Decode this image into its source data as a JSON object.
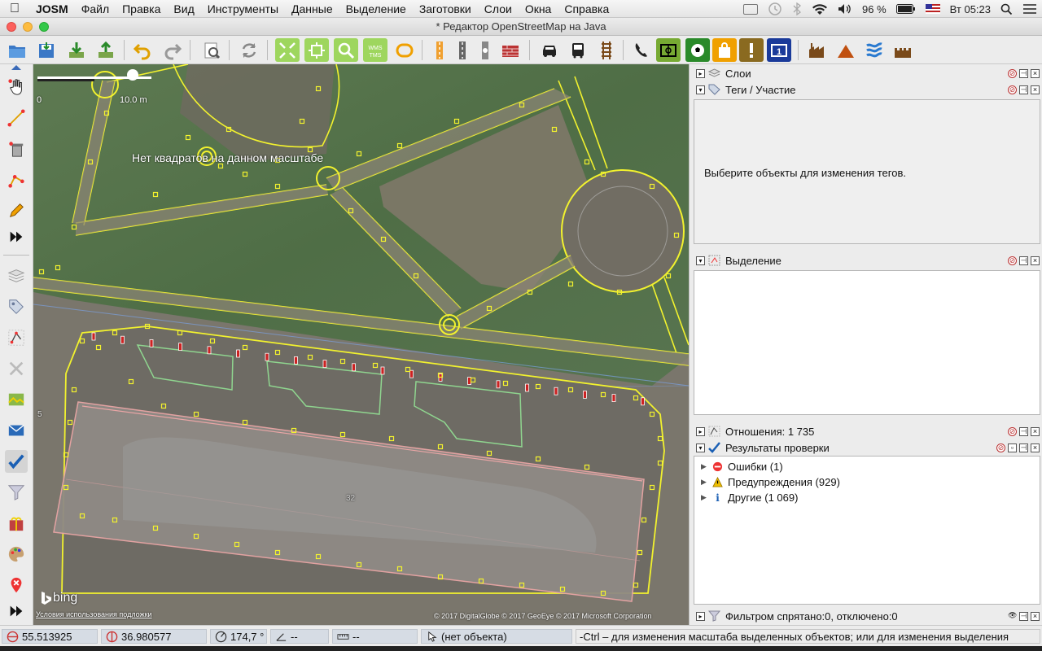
{
  "menubar": {
    "app": "JOSM",
    "items": [
      "Файл",
      "Правка",
      "Вид",
      "Инструменты",
      "Данные",
      "Выделение",
      "Заготовки",
      "Слои",
      "Окна",
      "Справка"
    ],
    "battery": "96 %",
    "clock": "Вт 05:23"
  },
  "window": {
    "title": "* Редактор OpenStreetMap на Java"
  },
  "map": {
    "scale_zero": "0",
    "scale_label": "10.0 m",
    "overlay_msg": "Нет квадратов на данном масштабе",
    "bing": "bing",
    "terms": "Условия использования подложки",
    "copyright": "© 2017 DigitalGlobe © 2017 GeoEye © 2017 Microsoft Corporation",
    "tick5": "5",
    "tick32": "32"
  },
  "panels": {
    "layers": {
      "label": "Слои"
    },
    "tags": {
      "label": "Теги / Участие",
      "empty_msg": "Выберите объекты для изменения тегов."
    },
    "selection": {
      "label": "Выделение"
    },
    "relations": {
      "label": "Отношения: 1 735"
    },
    "validation": {
      "label": "Результаты проверки",
      "items": [
        {
          "label": "Ошибки (1)"
        },
        {
          "label": "Предупреждения (929)"
        },
        {
          "label": "Другие (1 069)"
        }
      ]
    },
    "filter": {
      "label": "Фильтром спрятано:0, отключено:0"
    }
  },
  "status": {
    "lat": "55.513925",
    "lon": "36.980577",
    "heading": "174,7 °",
    "angle": "--",
    "distance": "--",
    "object": "(нет объекта)",
    "help": "-Ctrl – для изменения масштаба выделенных объектов; или для изменения выделения"
  },
  "colors": {
    "way": "#f2f22e",
    "building": "#e9a5a5",
    "park": "#8fd58f",
    "accent": "#1a5fb4"
  }
}
